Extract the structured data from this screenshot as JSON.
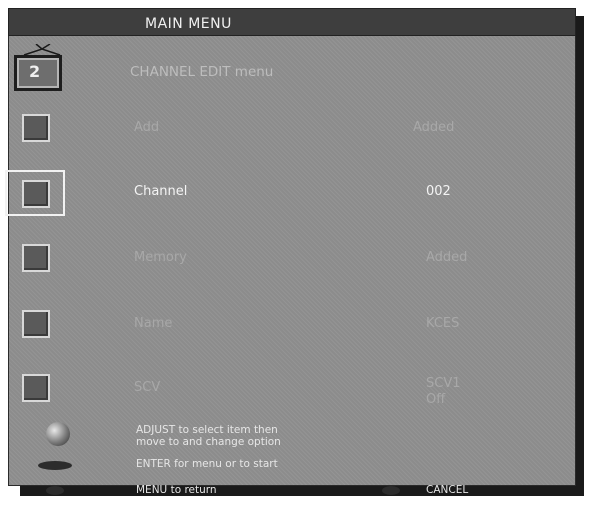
{
  "window": {
    "title": "MAIN MENU"
  },
  "submenu": {
    "title": "CHANNEL EDIT menu",
    "top_icon_glyph": "2"
  },
  "rows": [
    {
      "label": "Add",
      "value": "Added"
    },
    {
      "label": "Channel",
      "value": "002"
    },
    {
      "label": "Memory",
      "value": "Added"
    },
    {
      "label": "Name",
      "value": "KCES"
    },
    {
      "label": "SCV",
      "value": "SCV1",
      "value2": "Off"
    }
  ],
  "help": {
    "adjust_line1": "ADJUST to select item then",
    "adjust_line2": "move to and change option",
    "enter": "ENTER for menu or to start",
    "menu": "MENU to return",
    "cancel": "CANCEL"
  },
  "colors": {
    "panel": "#8c8c8c",
    "titlebar": "#3e3e3e",
    "selected_text": "#f4f4f4"
  }
}
